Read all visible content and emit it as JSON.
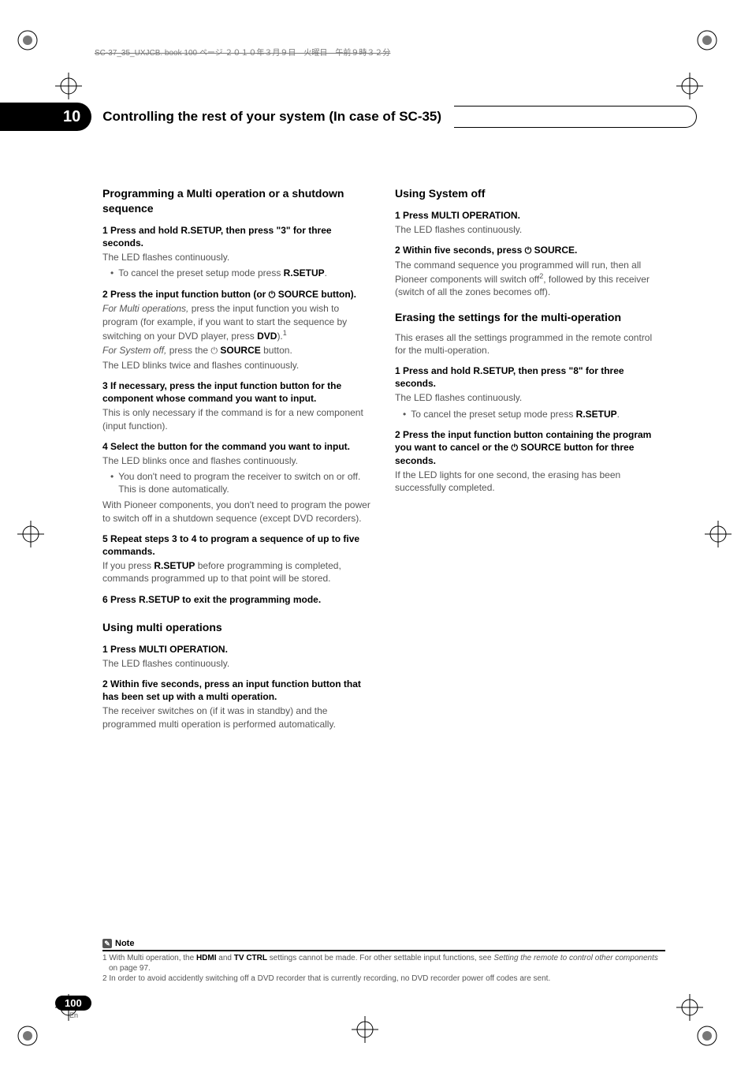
{
  "meta_header": "SC-37_35_UXJCB. book   100 ページ   ２０１０年３月９日　火曜日　午前９時３２分",
  "chapter": {
    "number": "10",
    "title": "Controlling the rest of your system (In case of SC-35)"
  },
  "left": {
    "h_prog": "Programming a Multi operation or a shutdown sequence",
    "s1_head": "1   Press and hold R.SETUP, then press \"3\" for three seconds.",
    "s1_p": "The LED flashes continuously.",
    "s1_b1a": "To cancel the preset setup mode press ",
    "s1_b1b": "R.SETUP",
    "s1_b1c": ".",
    "s2_head_a": "2   Press the input function button (or ",
    "s2_head_b": " SOURCE button).",
    "s2_p1a": "For Multi operations,",
    "s2_p1b": " press the input function you wish to program (for example, if you want to start the sequence by switching on your DVD player, press ",
    "s2_p1c": "DVD",
    "s2_p1d": ").",
    "s2_sup": "1",
    "s2_p2a": "For System off,",
    "s2_p2b": " press the ",
    "s2_p2c": " SOURCE",
    "s2_p2d": " button.",
    "s2_p3": "The LED blinks twice and flashes continuously.",
    "s3_head": "3   If necessary, press the input function button for the component whose command you want to input.",
    "s3_p": "This is only necessary if the command is for a new component (input function).",
    "s4_head": "4   Select the button for the command you want to input.",
    "s4_p": "The LED blinks once and flashes continuously.",
    "s4_b": "You don't need to program the receiver to switch on or off. This is done automatically.",
    "s4_p2": "With Pioneer components, you don't need to program the power to switch off in a shutdown sequence (except DVD recorders).",
    "s5_head": "5   Repeat steps 3 to 4 to program a sequence of up to five commands.",
    "s5_p_a": "If you press ",
    "s5_p_b": "R.SETUP",
    "s5_p_c": " before programming is completed, commands programmed up to that point will be stored.",
    "s6_head": "6   Press R.SETUP to exit the programming mode.",
    "h_multi": "Using multi operations",
    "m1_head": "1   Press MULTI OPERATION.",
    "m1_p": "The LED flashes continuously.",
    "m2_head": "2   Within five seconds, press an input function button that has been set up with a multi operation.",
    "m2_p": "The receiver switches on (if it was in standby) and the programmed multi operation is performed automatically."
  },
  "right": {
    "h_sysoff": "Using System off",
    "o1_head": "1   Press MULTI OPERATION.",
    "o1_p": "The LED flashes continuously.",
    "o2_head_a": "2   Within five seconds, press ",
    "o2_head_b": " SOURCE.",
    "o2_p_a": "The command sequence you programmed will run, then all Pioneer components will switch off",
    "o2_sup": "2",
    "o2_p_b": ", followed by this receiver (switch of all the zones becomes off).",
    "h_erase": "Erasing the settings for the multi-operation",
    "e_p": "This erases all the settings programmed in the remote control for the multi-operation.",
    "e1_head": "1   Press and hold R.SETUP, then press \"8\" for three seconds.",
    "e1_p": "The LED flashes continuously.",
    "e1_b_a": "To cancel the preset setup mode press ",
    "e1_b_b": "R.SETUP",
    "e1_b_c": ".",
    "e2_head_a": "2   Press the input function button containing the program you want to cancel or the ",
    "e2_head_b": " SOURCE button for three seconds.",
    "e2_p": "If the LED lights for one second, the erasing has been successfully completed."
  },
  "note": {
    "label": "Note",
    "f1_a": "1 With Multi operation, the ",
    "f1_b": "HDMI",
    "f1_c": " and ",
    "f1_d": "TV CTRL",
    "f1_e": " settings cannot be made. For other settable input functions, see ",
    "f1_f": "Setting the remote to control other components",
    "f1_g": " on page 97.",
    "f2": "2 In order to avoid accidently switching off a DVD recorder that is currently recording, no DVD recorder power off codes are sent."
  },
  "page": {
    "number": "100",
    "lang": "En"
  },
  "icons": {
    "power": "⏻"
  }
}
